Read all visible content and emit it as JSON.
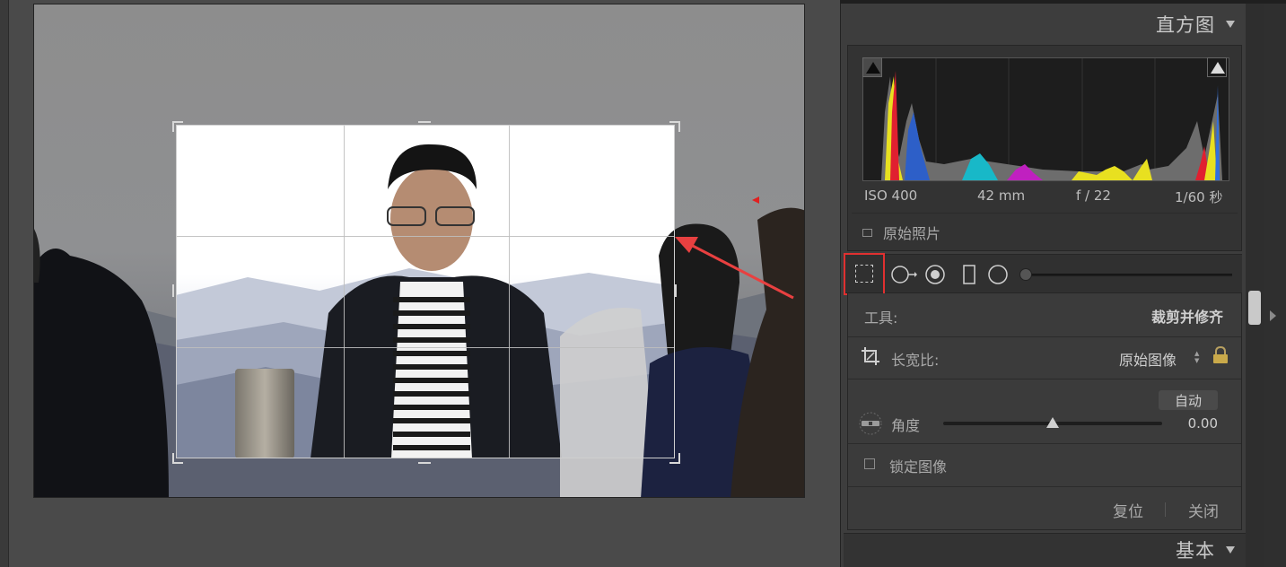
{
  "panels": {
    "histogram": {
      "title": "直方图",
      "exif": {
        "iso": "ISO 400",
        "focal": "42 mm",
        "aperture": "f / 22",
        "shutter": "1/60 秒"
      },
      "original_photo_label": "原始照片"
    },
    "crop": {
      "tool_label": "工具:",
      "tool_value": "裁剪并修齐",
      "aspect_label": "长宽比:",
      "aspect_value": "原始图像",
      "auto_label": "自动",
      "angle_label": "角度",
      "angle_value": "0.00",
      "angle_level": 0.5,
      "lock_image_label": "锁定图像",
      "reset_label": "复位",
      "close_label": "关闭"
    },
    "basic": {
      "title": "基本"
    }
  },
  "icons": {
    "crop_tool": "crop-overlay-icon",
    "spot_removal": "spot-removal-icon",
    "red_eye": "red-eye-icon",
    "graduated_filter": "graduated-filter-icon",
    "radial_filter": "radial-filter-icon",
    "brush": "adjustment-brush-icon",
    "lock": "lock-icon",
    "level": "straighten-level-icon"
  },
  "colors": {
    "highlight_box": "#e03030",
    "annotation_arrow": "#e84040",
    "panel_bg": "#3b3b3b",
    "workspace_bg": "#4a4a4a"
  }
}
